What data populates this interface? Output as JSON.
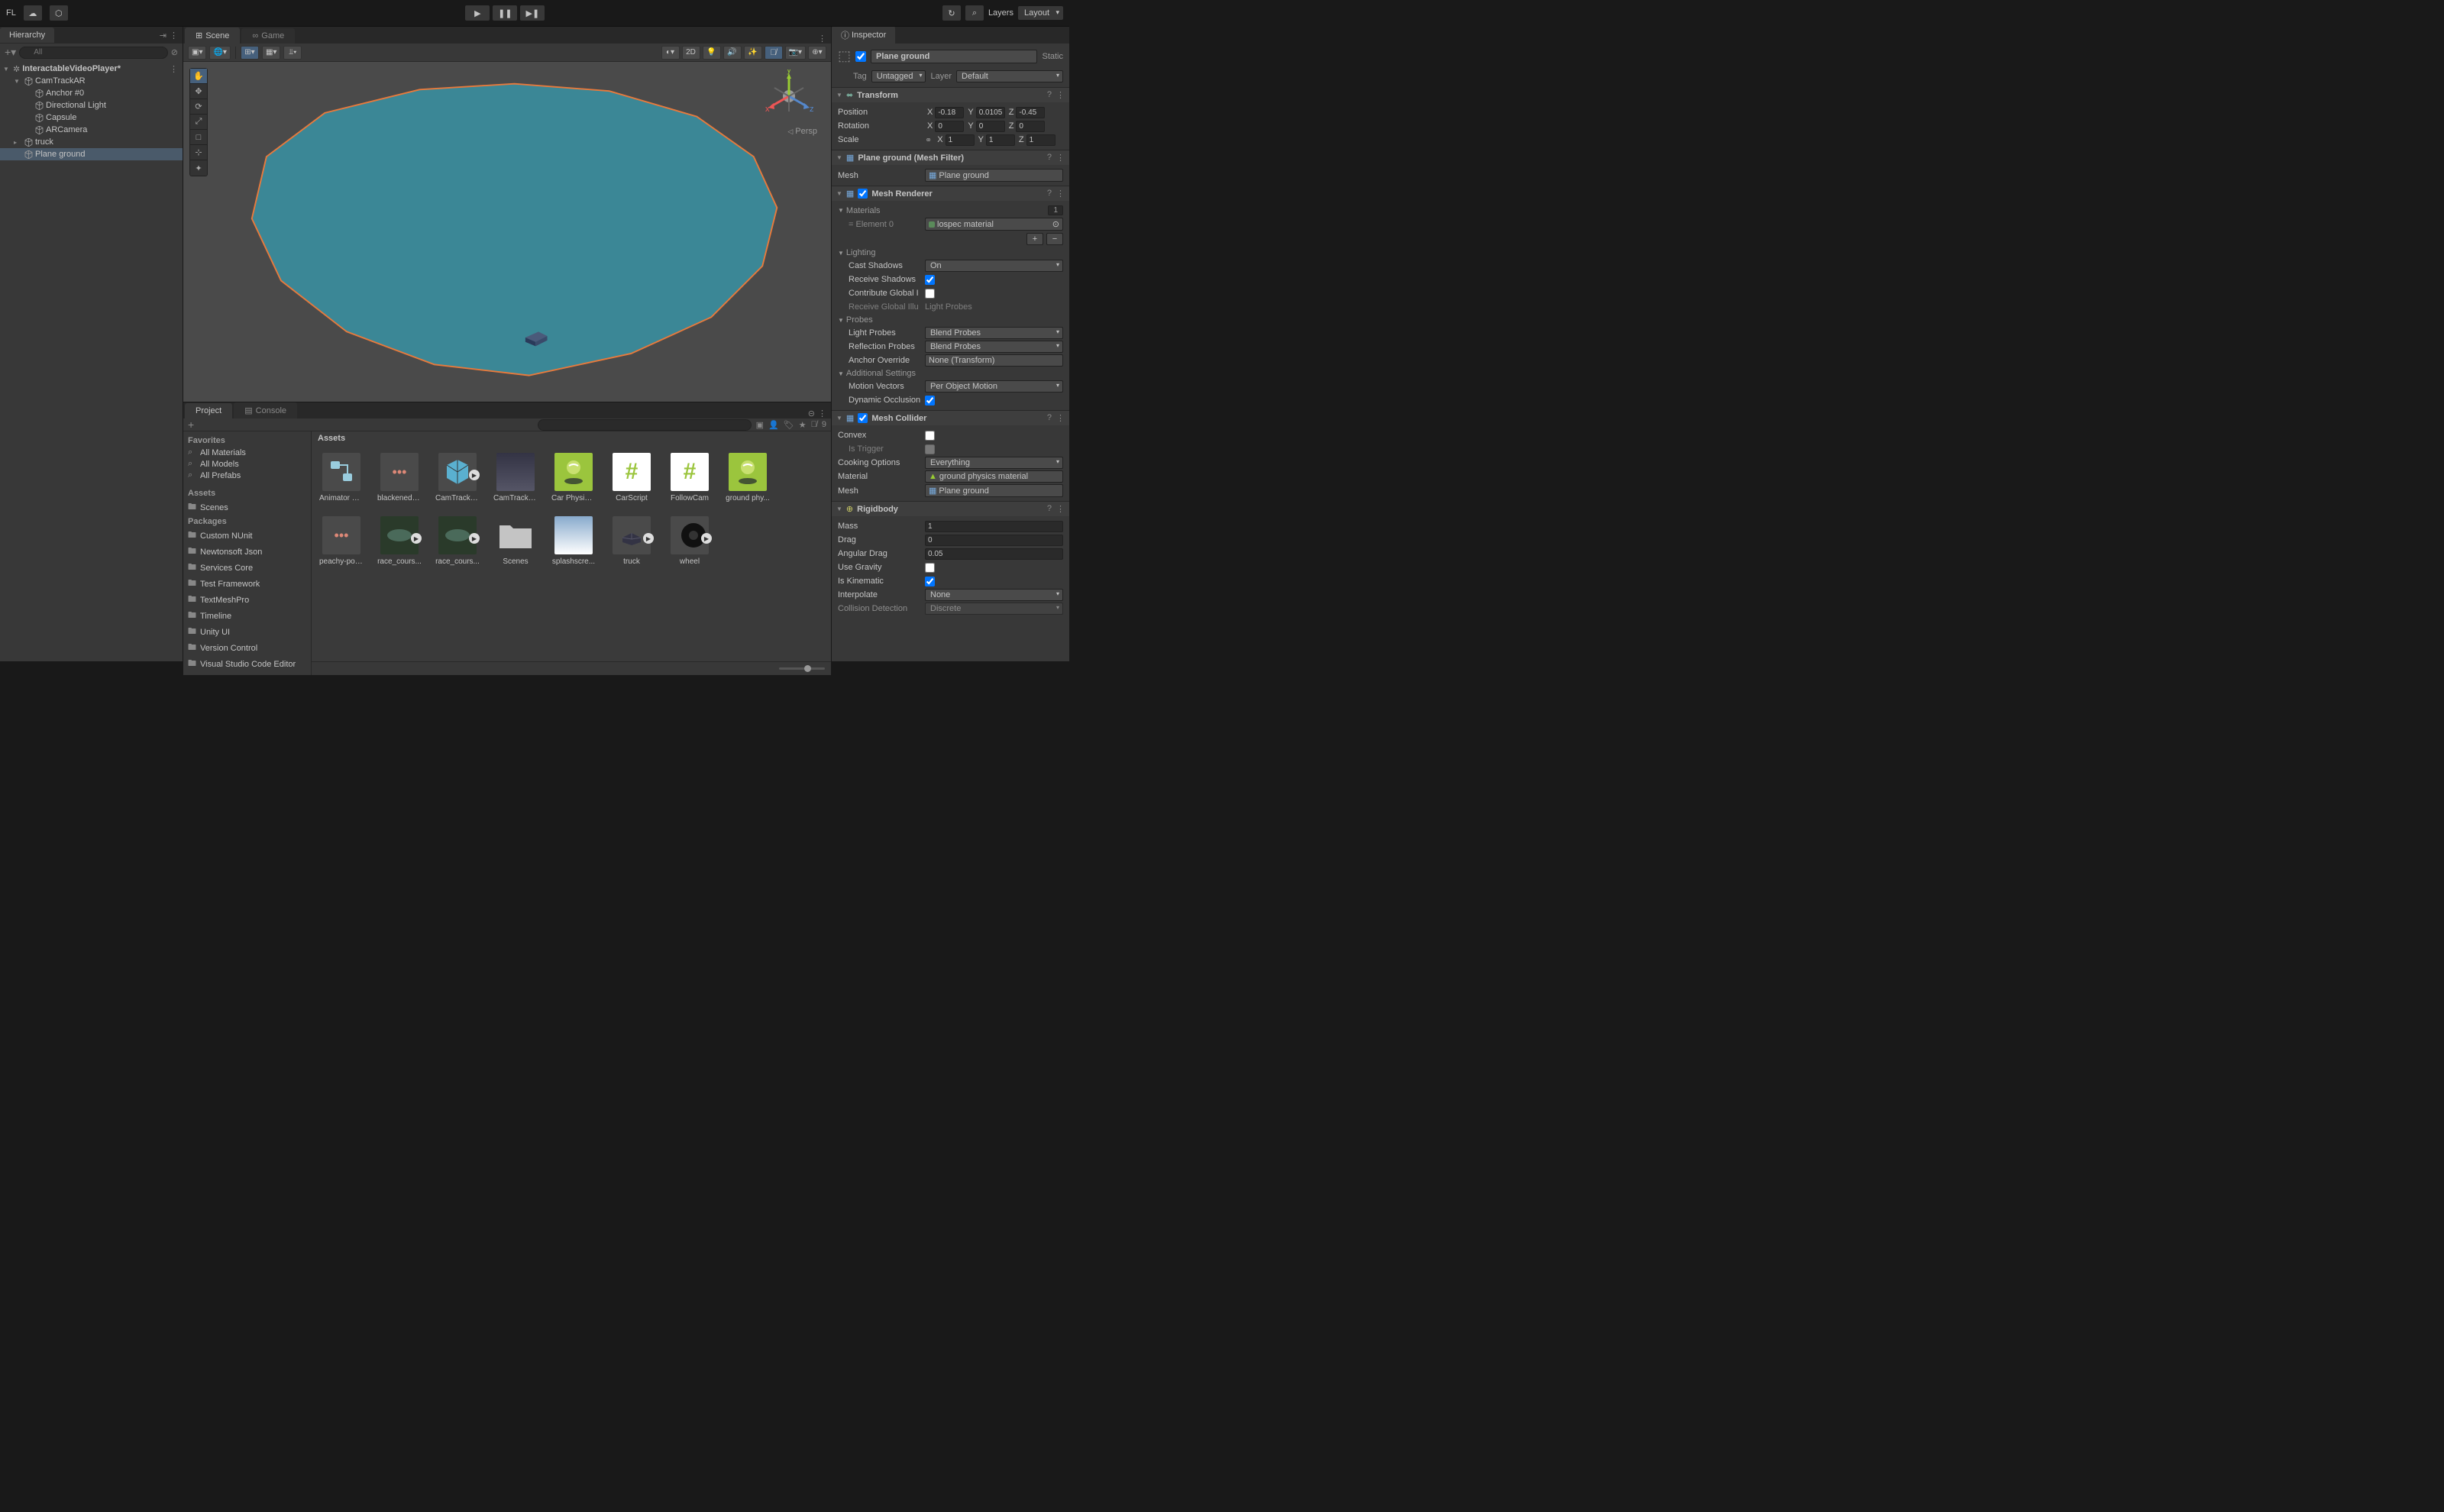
{
  "topbar": {
    "left_label": "FL",
    "layers": "Layers",
    "layout": "Layout"
  },
  "hierarchy": {
    "title": "Hierarchy",
    "search_placeholder": "All",
    "scene": "InteractableVideoPlayer*",
    "items": [
      {
        "name": "CamTrackAR",
        "depth": 1,
        "expanded": true
      },
      {
        "name": "Anchor #0",
        "depth": 2
      },
      {
        "name": "Directional Light",
        "depth": 2
      },
      {
        "name": "Capsule",
        "depth": 2
      },
      {
        "name": "ARCamera",
        "depth": 2
      },
      {
        "name": "truck",
        "depth": 1,
        "collapsed": true
      },
      {
        "name": "Plane ground",
        "depth": 1,
        "selected": true
      }
    ]
  },
  "scene": {
    "tab_scene": "Scene",
    "tab_game": "Game",
    "btn_2d": "2D",
    "persp": "Persp",
    "axis": {
      "x": "x",
      "y": "y",
      "z": "z"
    }
  },
  "project": {
    "tab_project": "Project",
    "tab_console": "Console",
    "breadcrumb": "Assets",
    "hidden_count": "9",
    "favorites_header": "Favorites",
    "favorites": [
      "All Materials",
      "All Models",
      "All Prefabs"
    ],
    "assets_header": "Assets",
    "assets_tree": [
      "Scenes"
    ],
    "packages_header": "Packages",
    "packages": [
      "Custom NUnit",
      "Newtonsoft Json",
      "Services Core",
      "Test Framework",
      "TextMeshPro",
      "Timeline",
      "Unity UI",
      "Version Control",
      "Visual Studio Code Editor"
    ],
    "assets": [
      {
        "name": "Animator C...",
        "type": "controller"
      },
      {
        "name": "blackened_...",
        "type": "material"
      },
      {
        "name": "CamTrackAR",
        "type": "prefab",
        "play": true
      },
      {
        "name": "CamTrackAR",
        "type": "image"
      },
      {
        "name": "Car Physics...",
        "type": "physmat"
      },
      {
        "name": "CarScript",
        "type": "script"
      },
      {
        "name": "FollowCam",
        "type": "script"
      },
      {
        "name": "ground phy...",
        "type": "physmat"
      },
      {
        "name": "peachy-pop...",
        "type": "material"
      },
      {
        "name": "race_cours...",
        "type": "video",
        "play": true
      },
      {
        "name": "race_cours...",
        "type": "video",
        "play": true
      },
      {
        "name": "Scenes",
        "type": "folder"
      },
      {
        "name": "splashscre...",
        "type": "image2"
      },
      {
        "name": "truck",
        "type": "model",
        "play": true
      },
      {
        "name": "wheel",
        "type": "wheel",
        "play": true
      }
    ]
  },
  "inspector": {
    "title": "Inspector",
    "object_name": "Plane ground",
    "static_label": "Static",
    "tag_label": "Tag",
    "tag_value": "Untagged",
    "layer_label": "Layer",
    "layer_value": "Default",
    "transform": {
      "title": "Transform",
      "position": {
        "label": "Position",
        "x": "-0.18",
        "y": "0.01058",
        "z": "-0.45"
      },
      "rotation": {
        "label": "Rotation",
        "x": "0",
        "y": "0",
        "z": "0"
      },
      "scale": {
        "label": "Scale",
        "x": "1",
        "y": "1",
        "z": "1"
      }
    },
    "mesh_filter": {
      "title": "Plane ground (Mesh Filter)",
      "mesh_label": "Mesh",
      "mesh_value": "Plane ground"
    },
    "mesh_renderer": {
      "title": "Mesh Renderer",
      "materials_label": "Materials",
      "materials_count": "1",
      "element0_label": "Element 0",
      "element0_value": "lospec material",
      "lighting_label": "Lighting",
      "cast_shadows_label": "Cast Shadows",
      "cast_shadows_value": "On",
      "receive_shadows_label": "Receive Shadows",
      "contribute_gi_label": "Contribute Global I",
      "receive_gi_label": "Receive Global Illu",
      "receive_gi_value": "Light Probes",
      "probes_label": "Probes",
      "light_probes_label": "Light Probes",
      "light_probes_value": "Blend Probes",
      "reflection_probes_label": "Reflection Probes",
      "reflection_probes_value": "Blend Probes",
      "anchor_override_label": "Anchor Override",
      "anchor_override_value": "None (Transform)",
      "additional_label": "Additional Settings",
      "motion_vectors_label": "Motion Vectors",
      "motion_vectors_value": "Per Object Motion",
      "dynamic_occlusion_label": "Dynamic Occlusion"
    },
    "mesh_collider": {
      "title": "Mesh Collider",
      "convex_label": "Convex",
      "is_trigger_label": "Is Trigger",
      "cooking_label": "Cooking Options",
      "cooking_value": "Everything",
      "material_label": "Material",
      "material_value": "ground physics material",
      "mesh_label": "Mesh",
      "mesh_value": "Plane ground"
    },
    "rigidbody": {
      "title": "Rigidbody",
      "mass_label": "Mass",
      "mass_value": "1",
      "drag_label": "Drag",
      "drag_value": "0",
      "angular_drag_label": "Angular Drag",
      "angular_drag_value": "0.05",
      "use_gravity_label": "Use Gravity",
      "is_kinematic_label": "Is Kinematic",
      "interpolate_label": "Interpolate",
      "interpolate_value": "None",
      "collision_label": "Collision Detection",
      "collision_value": "Discrete"
    }
  }
}
